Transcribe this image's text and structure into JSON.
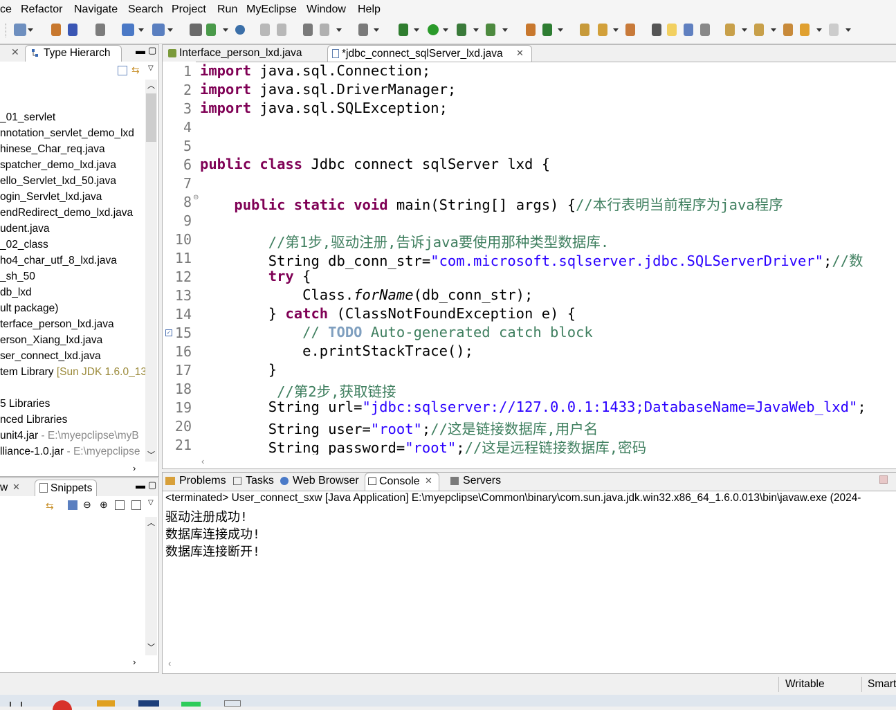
{
  "menu": [
    "ce",
    "Refactor",
    "Navigate",
    "Search",
    "Project",
    "Run",
    "MyEclipse",
    "Window",
    "Help"
  ],
  "left_panel": {
    "tab_label": "Type Hierarch",
    "items": [
      {
        "text": "_01_servlet"
      },
      {
        "text": "nnotation_servlet_demo_lxd"
      },
      {
        "text": "hinese_Char_req.java"
      },
      {
        "text": "spatcher_demo_lxd.java"
      },
      {
        "text": "ello_Servlet_lxd_50.java"
      },
      {
        "text": "ogin_Servlet_lxd.java"
      },
      {
        "text": "endRedirect_demo_lxd.java"
      },
      {
        "text": "udent.java"
      },
      {
        "text": "_02_class"
      },
      {
        "text": "ho4_char_utf_8_lxd.java"
      },
      {
        "text": "_sh_50"
      },
      {
        "text": "db_lxd"
      },
      {
        "text": "ult package)"
      },
      {
        "text": "terface_person_lxd.java"
      },
      {
        "text": "erson_Xiang_lxd.java"
      },
      {
        "text": "ser_connect_lxd.java"
      },
      {
        "text": "tem Library",
        "suffix": " [Sun JDK 1.6.0_13"
      },
      {
        "text": ""
      },
      {
        "text": "5 Libraries"
      },
      {
        "text": "nced Libraries"
      },
      {
        "text": "unit4.jar",
        "suffix": " - E:\\myepclipse\\myB"
      },
      {
        "text": "lliance-1.0.jar",
        "suffix": " - E:\\myepclipse"
      }
    ]
  },
  "left_panel2": {
    "tab1": "w",
    "tab2": "Snippets"
  },
  "editor": {
    "tabs": [
      {
        "label": "Interface_person_lxd.java",
        "active": false
      },
      {
        "label": "*jdbc_connect_sqlServer_lxd.java",
        "active": true
      }
    ],
    "lines": [
      {
        "n": "1",
        "segs": [
          {
            "t": "import",
            "c": "kw"
          },
          {
            "t": " java.sql.Connection;"
          }
        ]
      },
      {
        "n": "2",
        "segs": [
          {
            "t": "import",
            "c": "kw"
          },
          {
            "t": " java.sql.DriverManager;"
          }
        ]
      },
      {
        "n": "3",
        "segs": [
          {
            "t": "import",
            "c": "kw"
          },
          {
            "t": " java.sql.SQLException;"
          }
        ]
      },
      {
        "n": "4",
        "segs": []
      },
      {
        "n": "5",
        "segs": []
      },
      {
        "n": "6",
        "segs": [
          {
            "t": "public",
            "c": "kw"
          },
          {
            "t": " "
          },
          {
            "t": "class",
            "c": "kw"
          },
          {
            "t": " Jdbc connect sqlServer lxd {"
          }
        ]
      },
      {
        "n": "7",
        "segs": []
      },
      {
        "n": "8",
        "segs": [
          {
            "t": "    "
          },
          {
            "t": "public",
            "c": "kw"
          },
          {
            "t": " "
          },
          {
            "t": "static",
            "c": "kw"
          },
          {
            "t": " "
          },
          {
            "t": "void",
            "c": "kw"
          },
          {
            "t": " main(String[] args) {"
          },
          {
            "t": "//本行表明当前程序为java程序",
            "c": "cm"
          }
        ]
      },
      {
        "n": "9",
        "segs": []
      },
      {
        "n": "10",
        "segs": [
          {
            "t": "        "
          },
          {
            "t": "//第1步,驱动注册,告诉java要使用那种类型数据库.",
            "c": "cm"
          }
        ]
      },
      {
        "n": "11",
        "segs": [
          {
            "t": "        String db_conn_str="
          },
          {
            "t": "\"com.microsoft.sqlserver.jdbc.SQLServerDriver\"",
            "c": "str"
          },
          {
            "t": ";"
          },
          {
            "t": "//数",
            "c": "cm"
          }
        ]
      },
      {
        "n": "12",
        "segs": [
          {
            "t": "        "
          },
          {
            "t": "try",
            "c": "kw"
          },
          {
            "t": " {"
          }
        ]
      },
      {
        "n": "13",
        "segs": [
          {
            "t": "            Class."
          },
          {
            "t": "forName",
            "c": "it"
          },
          {
            "t": "(db_conn_str);"
          }
        ]
      },
      {
        "n": "14",
        "segs": [
          {
            "t": "        } "
          },
          {
            "t": "catch",
            "c": "kw"
          },
          {
            "t": " (ClassNotFoundException e) {"
          }
        ]
      },
      {
        "n": "15",
        "segs": [
          {
            "t": "            "
          },
          {
            "t": "// ",
            "c": "cm"
          },
          {
            "t": "TODO",
            "c": "todo"
          },
          {
            "t": " Auto-generated catch block",
            "c": "cm"
          }
        ]
      },
      {
        "n": "16",
        "segs": [
          {
            "t": "            e.printStackTrace();"
          }
        ]
      },
      {
        "n": "17",
        "segs": [
          {
            "t": "        }"
          }
        ]
      },
      {
        "n": "18",
        "segs": [
          {
            "t": "         "
          },
          {
            "t": "//第2步,获取链接",
            "c": "cm"
          }
        ]
      },
      {
        "n": "19",
        "segs": [
          {
            "t": "        String url="
          },
          {
            "t": "\"jdbc:sqlserver://127.0.0.1:1433;DatabaseName=JavaWeb_lxd\"",
            "c": "str"
          },
          {
            "t": ";"
          }
        ]
      },
      {
        "n": "20",
        "segs": [
          {
            "t": "        String user="
          },
          {
            "t": "\"root\"",
            "c": "str"
          },
          {
            "t": ";"
          },
          {
            "t": "//这是链接数据库,用户名",
            "c": "cm"
          }
        ]
      },
      {
        "n": "21",
        "segs": [
          {
            "t": "        String password="
          },
          {
            "t": "\"root\"",
            "c": "str"
          },
          {
            "t": ";"
          },
          {
            "t": "//这是远程链接数据库,密码",
            "c": "cm"
          }
        ]
      }
    ]
  },
  "console": {
    "tabs": [
      "Problems",
      "Tasks",
      "Web Browser",
      "Console",
      "Servers"
    ],
    "terminated_line": "<terminated> User_connect_sxw [Java Application] E:\\myepclipse\\Common\\binary\\com.sun.java.jdk.win32.x86_64_1.6.0.013\\bin\\javaw.exe (2024-",
    "output": [
      "驱动注册成功!",
      "数据库连接成功!",
      "数据库连接断开!"
    ]
  },
  "status": {
    "writable": "Writable",
    "insert_mode": "Smart"
  }
}
